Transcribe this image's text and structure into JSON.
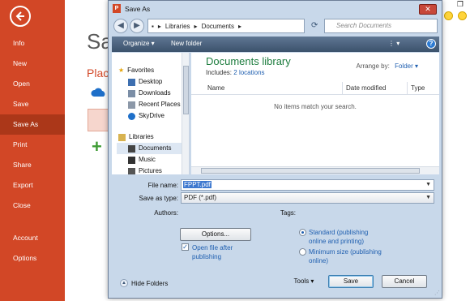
{
  "backstage": {
    "nav": [
      "Info",
      "New",
      "Open",
      "Save",
      "Save As",
      "Print",
      "Share",
      "Export",
      "Close",
      "Account",
      "Options"
    ],
    "title": "Sa",
    "places": "Place"
  },
  "dialog": {
    "title": "Save As",
    "close_label": "✕",
    "breadcrumb": [
      "Libraries",
      "Documents"
    ],
    "search_placeholder": "Search Documents",
    "toolbar": {
      "organize": "Organize ▾",
      "new_folder": "New folder"
    },
    "nav_pane": {
      "favorites_header": "Favorites",
      "favorites": [
        "Desktop",
        "Downloads",
        "Recent Places",
        "SkyDrive"
      ],
      "libraries_header": "Libraries",
      "libraries": [
        "Documents",
        "Music",
        "Pictures"
      ]
    },
    "library": {
      "title": "Documents library",
      "includes_label": "Includes:",
      "includes_value": "2 locations",
      "arrange_label": "Arrange by:",
      "arrange_value": "Folder ▾",
      "columns": [
        "Name",
        "Date modified",
        "Type"
      ],
      "empty": "No items match your search."
    },
    "form": {
      "file_name_label": "File name:",
      "file_name_value": "FPPT.pdf",
      "save_type_label": "Save as type:",
      "save_type_value": "PDF (*.pdf)",
      "authors_label": "Authors:",
      "tags_label": "Tags:"
    },
    "options_button": "Options...",
    "open_after": {
      "checked": true,
      "label": "Open file after publishing"
    },
    "optimize": [
      {
        "label": "Standard (publishing online and printing)",
        "selected": true
      },
      {
        "label": "Minimum size (publishing online)",
        "selected": false
      }
    ],
    "hide_folders": "Hide Folders",
    "tools": "Tools ▾",
    "save": "Save",
    "cancel": "Cancel"
  }
}
